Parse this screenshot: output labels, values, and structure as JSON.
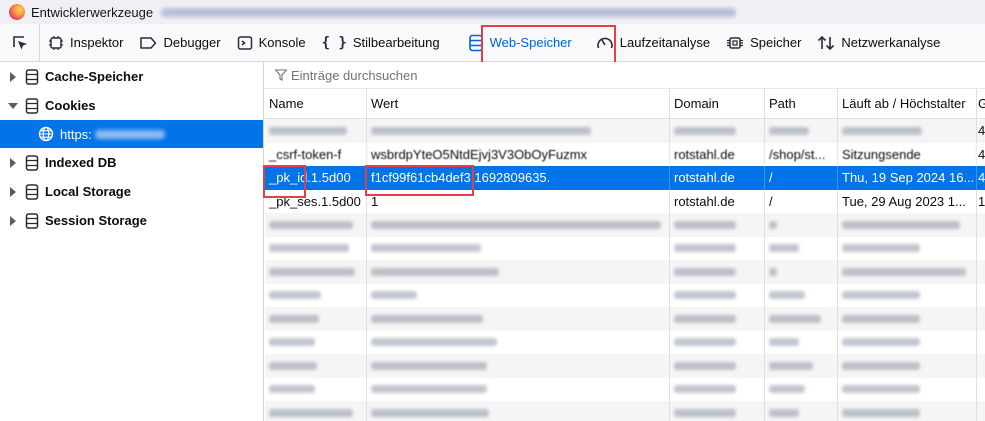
{
  "window": {
    "title": "Entwicklerwerkzeuge"
  },
  "toolbar": {
    "tabs": [
      {
        "label": "Inspektor",
        "icon": "inspector-icon"
      },
      {
        "label": "Debugger",
        "icon": "debugger-icon"
      },
      {
        "label": "Konsole",
        "icon": "console-icon"
      },
      {
        "label": "Stilbearbeitung",
        "icon": "style-editor-icon"
      },
      {
        "label": "Web-Speicher",
        "icon": "storage-icon"
      },
      {
        "label": "Laufzeitanalyse",
        "icon": "performance-icon"
      },
      {
        "label": "Speicher",
        "icon": "memory-icon"
      },
      {
        "label": "Netzwerkanalyse",
        "icon": "network-icon"
      }
    ],
    "active_tab": "Web-Speicher",
    "accent_color": "#0061e0",
    "highlight_color": "#e24044"
  },
  "sidebar": {
    "items": [
      {
        "label": "Cache-Speicher",
        "expanded": false
      },
      {
        "label": "Cookies",
        "expanded": true
      },
      {
        "label": "Indexed DB",
        "expanded": false
      },
      {
        "label": "Local Storage",
        "expanded": false
      },
      {
        "label": "Session Storage",
        "expanded": false
      }
    ],
    "selected_child": {
      "label": "https:"
    }
  },
  "filter": {
    "placeholder": "Einträge durchsuchen"
  },
  "table": {
    "headers": [
      "Name",
      "Wert",
      "Domain",
      "Path",
      "Läuft ab / Höchstalter",
      "G"
    ],
    "rows": [
      {
        "name": "",
        "value": "",
        "domain": "",
        "path": "",
        "expires": "",
        "extra": "4"
      },
      {
        "name": "_csrf-token-f",
        "value": "wsbrdpYteO5NtdEjvj3V3ObOyFuzmx",
        "domain": "rotstahl.de",
        "path": "/shop/st...",
        "expires": "Sitzungsende",
        "extra": "4"
      },
      {
        "name": "_pk_id.1.5d00",
        "value": "f1cf99f61cb4def3.1692809635.",
        "domain": "rotstahl.de",
        "path": "/",
        "expires": "Thu, 19 Sep 2024 16...",
        "extra": "4",
        "selected": true
      },
      {
        "name": "_pk_ses.1.5d00",
        "value": "1",
        "domain": "rotstahl.de",
        "path": "/",
        "expires": "Tue, 29 Aug 2023 1...",
        "extra": "1"
      },
      {
        "name": "",
        "value": "",
        "domain": "",
        "path": "",
        "expires": "",
        "extra": ""
      },
      {
        "name": "",
        "value": "",
        "domain": "",
        "path": "",
        "expires": "",
        "extra": ""
      },
      {
        "name": "",
        "value": "",
        "domain": "",
        "path": "",
        "expires": "",
        "extra": ""
      },
      {
        "name": "",
        "value": "",
        "domain": "",
        "path": "",
        "expires": "",
        "extra": ""
      },
      {
        "name": "",
        "value": "",
        "domain": "",
        "path": "",
        "expires": "",
        "extra": ""
      },
      {
        "name": "",
        "value": "",
        "domain": "",
        "path": "",
        "expires": "",
        "extra": ""
      },
      {
        "name": "",
        "value": "",
        "domain": "",
        "path": "",
        "expires": "",
        "extra": ""
      },
      {
        "name": "",
        "value": "",
        "domain": "",
        "path": "",
        "expires": "",
        "extra": ""
      },
      {
        "name": "",
        "value": "",
        "domain": "",
        "path": "",
        "expires": "",
        "extra": ""
      }
    ]
  }
}
